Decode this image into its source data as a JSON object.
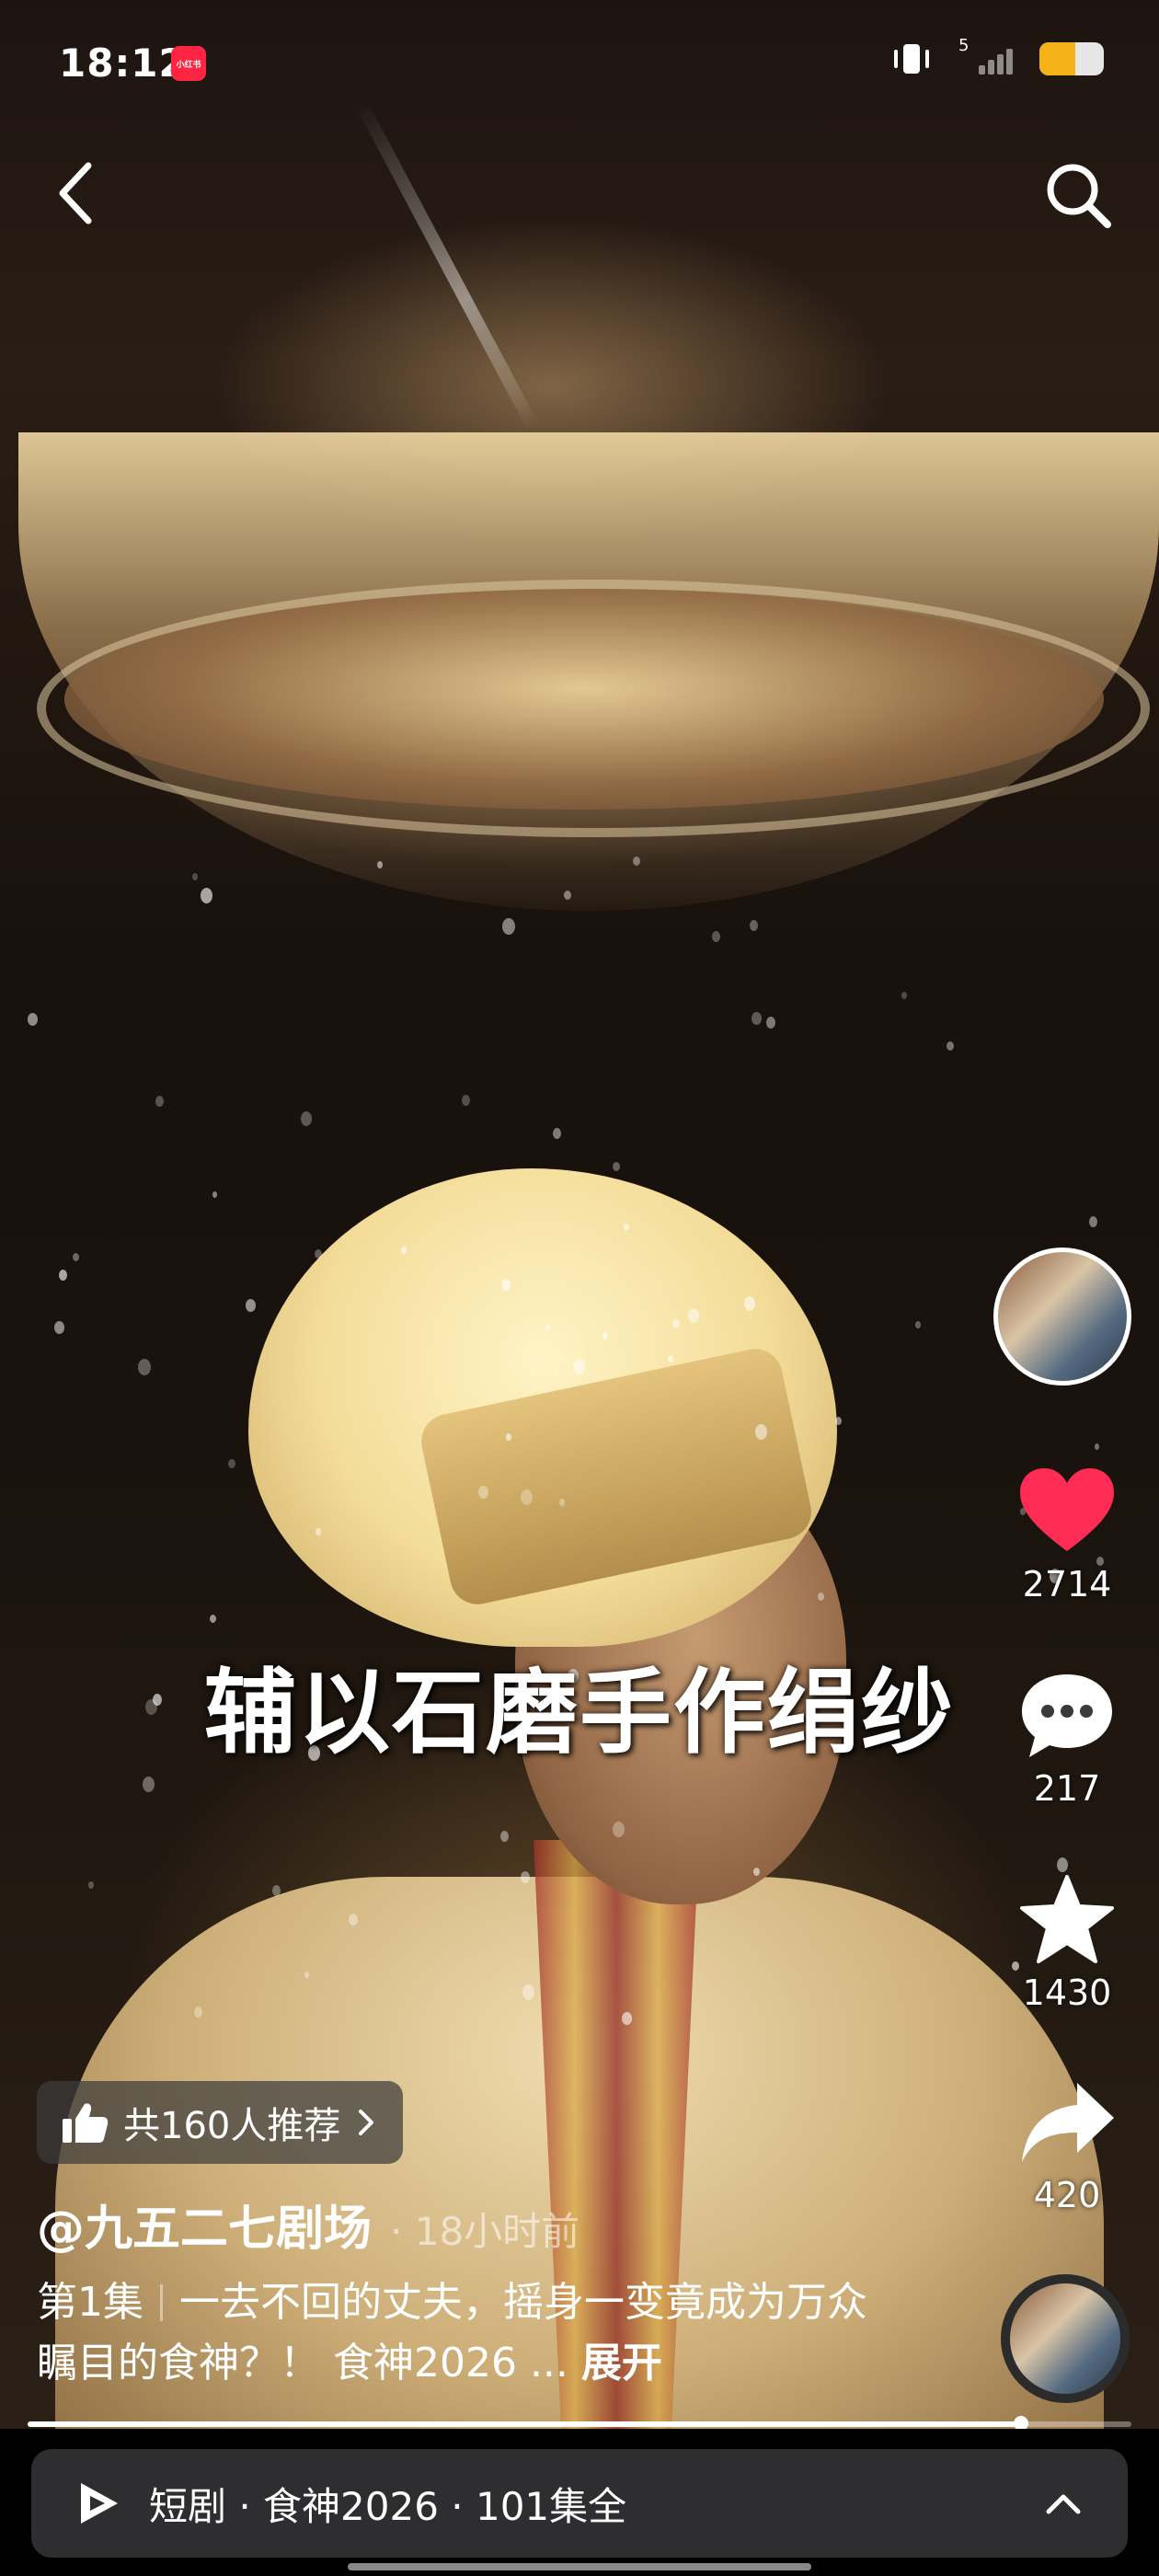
{
  "status_bar": {
    "time": "18:12",
    "app_icon": "小红书",
    "signal_label": "5",
    "battery_level": 0.55,
    "battery_color": "#f5b21a"
  },
  "nav": {
    "back_icon": "chevron-left-icon",
    "search_icon": "search-icon"
  },
  "video": {
    "subtitle": "辅以石磨手作绢纱",
    "progress": 0.9
  },
  "right_rail": {
    "likes": "2714",
    "comments": "217",
    "favorites": "1430",
    "shares": "420",
    "like_color": "#ff2d55"
  },
  "recommend": {
    "label": "共160人推荐"
  },
  "post": {
    "author": "@九五二七剧场",
    "time": "· 18小时前",
    "episode": "第1集",
    "description": "一去不回的丈夫，摇身一变竟成为万众瞩目的食神？！ 食神2026 ...",
    "expand_label": "展开"
  },
  "drama_bar": {
    "label": "短剧 · 食神2026 · 101集全"
  }
}
